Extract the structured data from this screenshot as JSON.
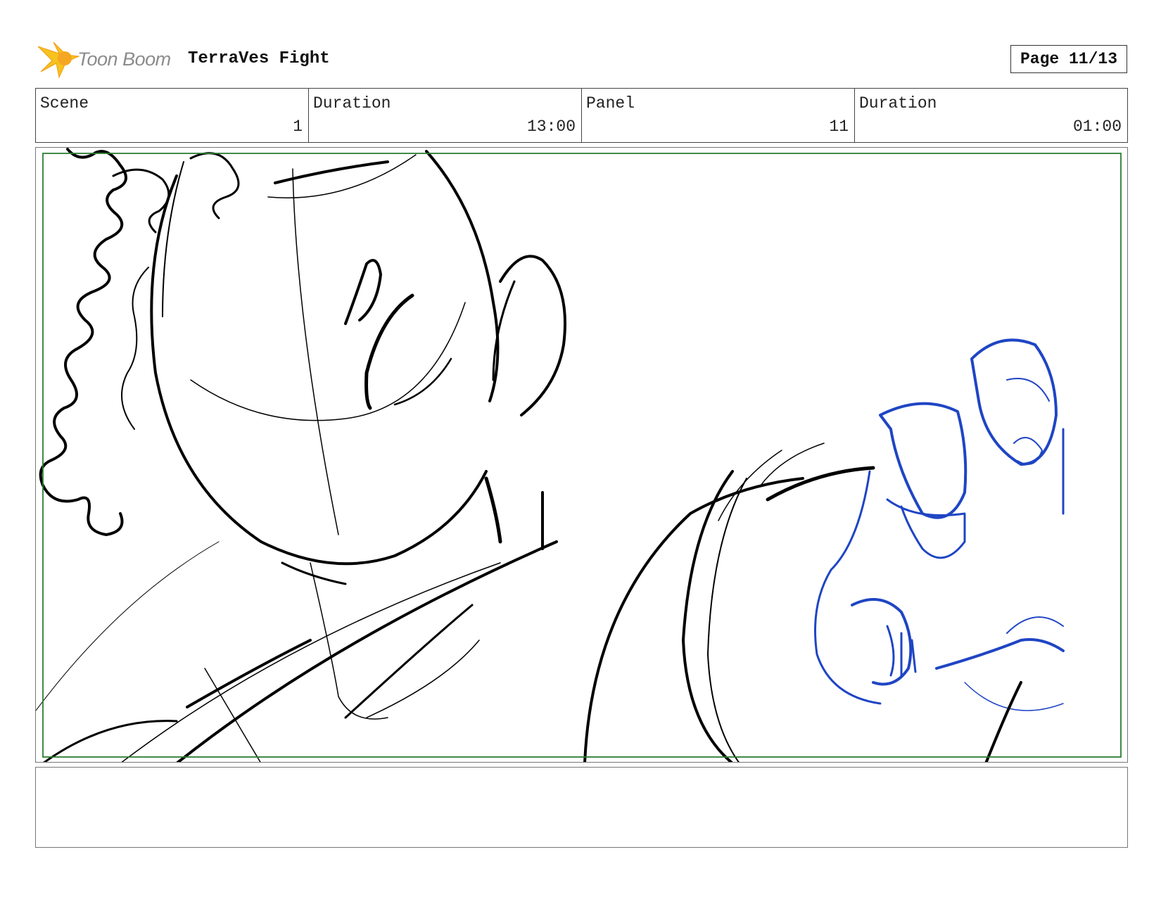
{
  "header": {
    "logo_text": "Toon Boom",
    "title": "TerraVes Fight",
    "page_label": "Page 11/13"
  },
  "info": [
    {
      "label": "Scene",
      "value": "1"
    },
    {
      "label": "Duration",
      "value": "13:00"
    },
    {
      "label": "Panel",
      "value": "11"
    },
    {
      "label": "Duration",
      "value": "01:00"
    }
  ],
  "panel": {
    "safe_area_color": "#2e7d32",
    "sketch_colors": {
      "ink": "#000000",
      "blue_ink": "#1f45c4"
    }
  },
  "notes": {
    "text": ""
  }
}
